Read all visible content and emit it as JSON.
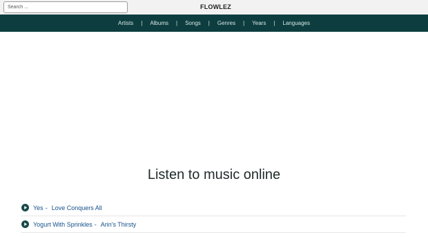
{
  "search": {
    "placeholder": "Search ..."
  },
  "brand": "FLOWLEZ",
  "nav": {
    "items": [
      {
        "label": "Artists"
      },
      {
        "label": "Albums"
      },
      {
        "label": "Songs"
      },
      {
        "label": "Genres"
      },
      {
        "label": "Years"
      },
      {
        "label": "Languages"
      }
    ],
    "separator": "|"
  },
  "hero": {
    "title": "Listen to music online"
  },
  "songs": [
    {
      "artist": "Yes",
      "separator": "-",
      "title": "Love Conquers All",
      "icon": "play-circle-icon"
    },
    {
      "artist": "Yogurt With Sprinkles",
      "separator": "-",
      "title": "Arin's Thirsty",
      "icon": "play-circle-icon"
    }
  ],
  "colors": {
    "navbar": "#0d3d3f",
    "topbar": "#f2f2f2",
    "link": "#15508a",
    "play_icon": "#1a4a4c"
  }
}
